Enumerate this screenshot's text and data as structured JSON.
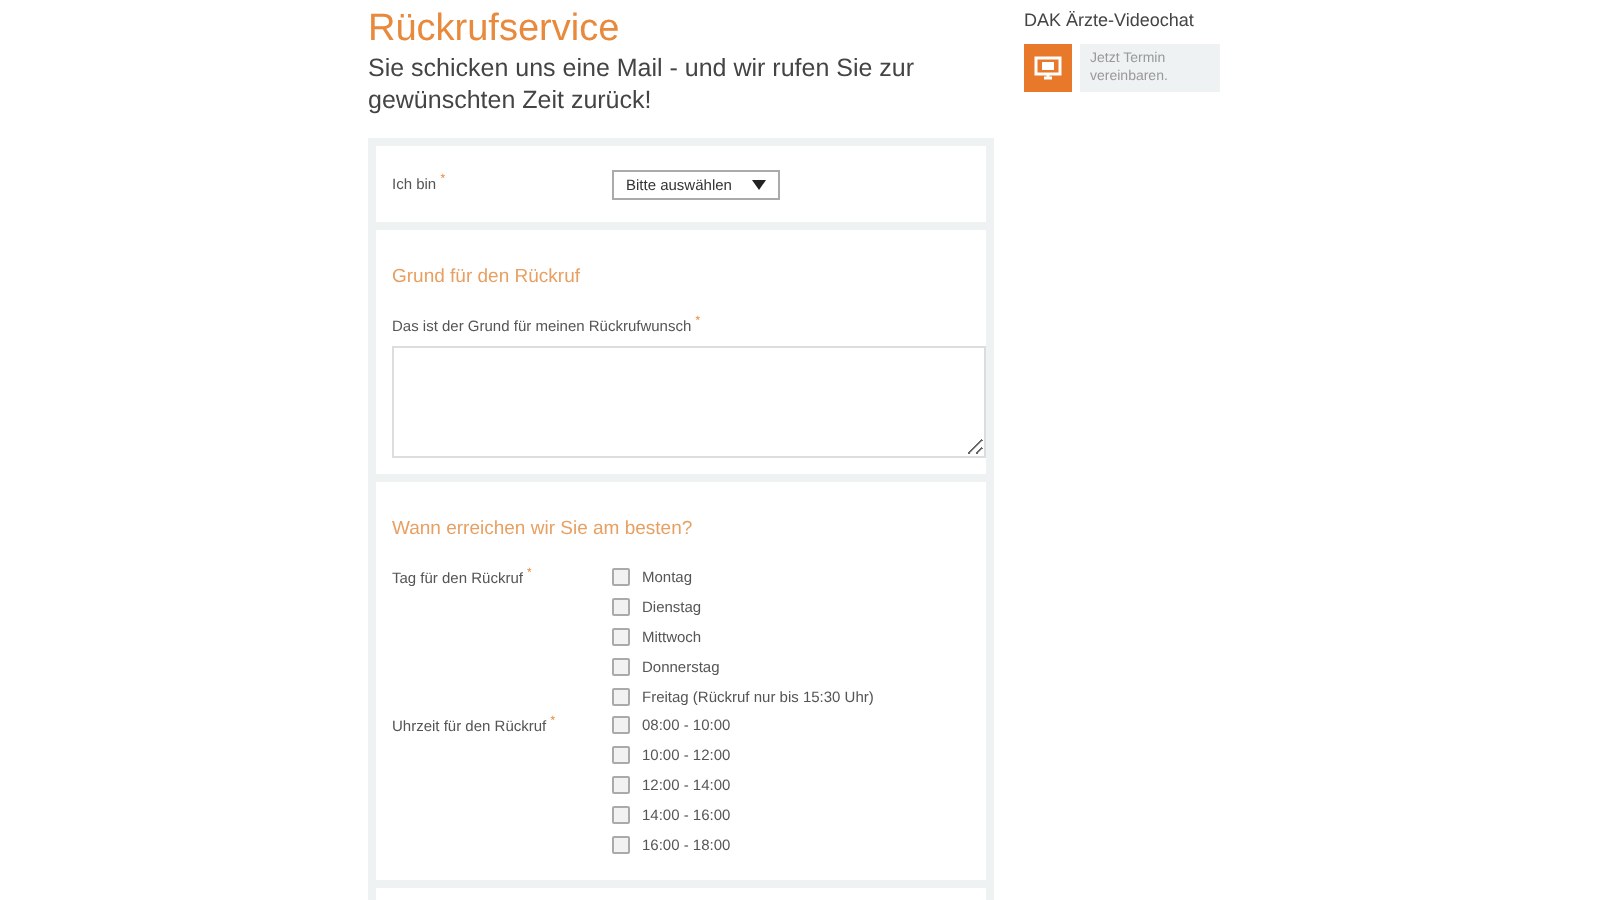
{
  "title": "Rückrufservice",
  "subtitle": "Sie schicken uns eine Mail - und wir rufen Sie zur gewünschten Zeit zurück!",
  "who": {
    "label": "Ich bin",
    "mark": "*",
    "select": "Bitte auswählen"
  },
  "reason": {
    "heading": "Grund für den Rückruf",
    "label": "Das ist der Grund für meinen Rückrufwunsch",
    "mark": "*"
  },
  "when": {
    "heading": "Wann erreichen wir Sie am besten?",
    "groups": [
      {
        "label": "Tag für den Rückruf",
        "mark": "*",
        "options": [
          {
            "label": "Montag",
            "checked": false
          },
          {
            "label": "Dienstag",
            "checked": false
          },
          {
            "label": "Mittwoch",
            "checked": false
          },
          {
            "label": "Donnerstag",
            "checked": false
          },
          {
            "label": "Freitag (Rückruf nur bis 15:30 Uhr)",
            "checked": false
          }
        ]
      },
      {
        "label": "Uhrzeit für den Rückruf",
        "mark": "*",
        "options": [
          {
            "label": "08:00 - 10:00",
            "checked": false
          },
          {
            "label": "10:00 - 12:00",
            "checked": false
          },
          {
            "label": "12:00 - 14:00",
            "checked": false
          },
          {
            "label": "14:00 - 16:00",
            "checked": false
          },
          {
            "label": "16:00 - 18:00",
            "checked": false
          }
        ]
      }
    ]
  },
  "sidebar": {
    "title": "DAK Ärzte-Videochat",
    "link": "Jetzt Termin vereinbaren."
  }
}
